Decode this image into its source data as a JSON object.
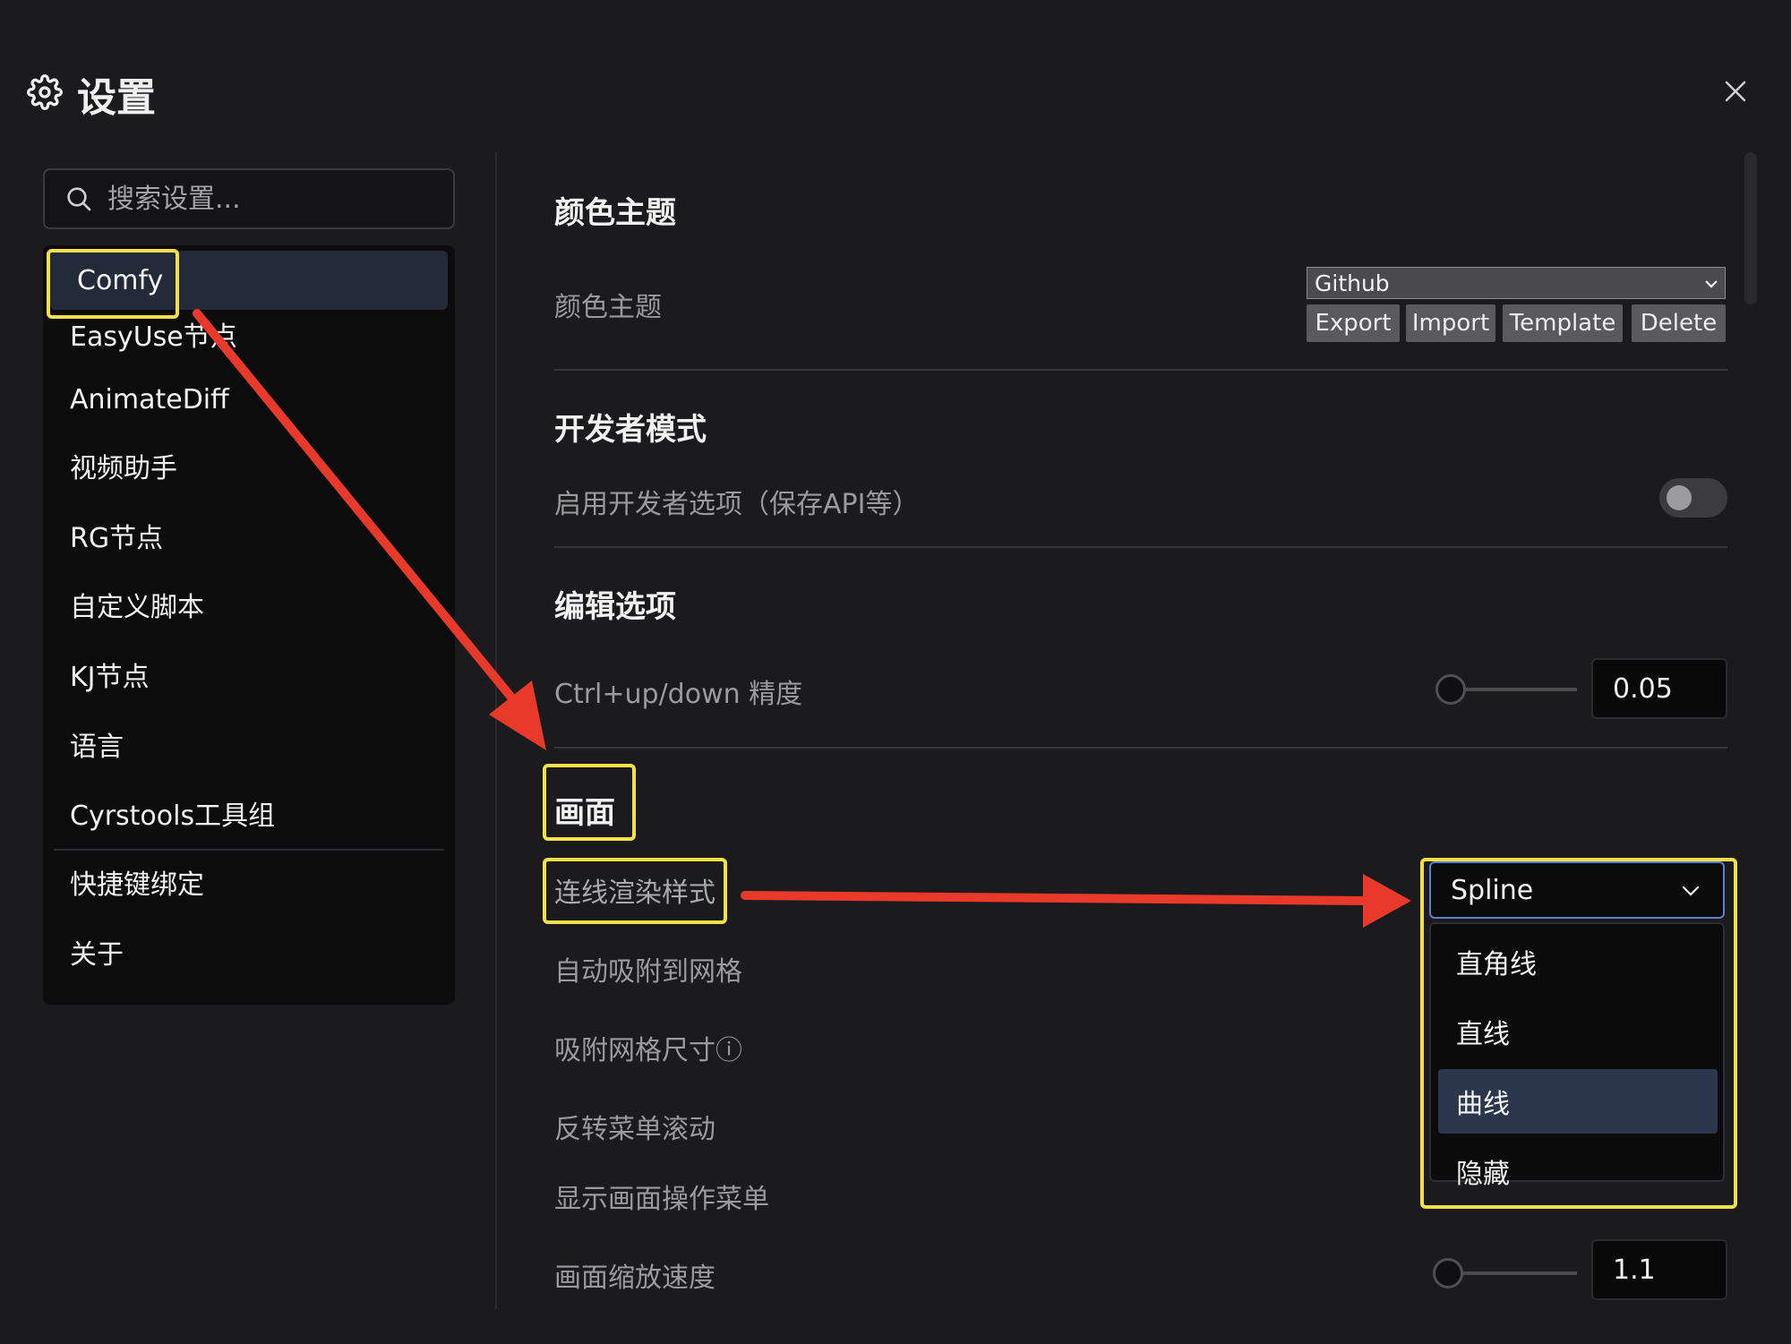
{
  "header": {
    "title": "设置",
    "icon": "gear-icon",
    "close_icon": "close-icon"
  },
  "search": {
    "placeholder": "搜索设置..."
  },
  "sidebar": {
    "items": [
      {
        "label": "Comfy"
      },
      {
        "label": "EasyUse节点"
      },
      {
        "label": "AnimateDiff"
      },
      {
        "label": "视频助手"
      },
      {
        "label": "RG节点"
      },
      {
        "label": "自定义脚本"
      },
      {
        "label": "KJ节点"
      },
      {
        "label": "语言"
      },
      {
        "label": "Cyrstools工具组"
      },
      {
        "label": "快捷键绑定"
      },
      {
        "label": "关于"
      }
    ],
    "selected": "Comfy"
  },
  "sections": {
    "color_theme": {
      "title": "颜色主题",
      "label": "颜色主题",
      "select_value": "Github",
      "buttons": [
        "Export",
        "Import",
        "Template",
        "Delete"
      ]
    },
    "dev_mode": {
      "title": "开发者模式",
      "label": "启用开发者选项（保存API等）",
      "toggle_on": false
    },
    "edit": {
      "title": "编辑选项",
      "label": "Ctrl+up/down 精度",
      "value": "0.05",
      "slider_level": 0
    },
    "canvas": {
      "title": "画面",
      "rows": [
        "连线渲染样式",
        "自动吸附到网格",
        "吸附网格尺寸ⓘ",
        "反转菜单滚动",
        "显示画面操作菜单",
        "画面缩放速度"
      ],
      "link_style_value": "Spline",
      "link_style_options": [
        "直角线",
        "直线",
        "曲线",
        "隐藏"
      ],
      "link_style_highlighted": "曲线",
      "zoom_speed_value": "1.1",
      "zoom_slider_level": 0
    }
  },
  "colors": {
    "highlight": "#f4e04a",
    "arrow": "#e8392a",
    "accent": "#5c7fd6",
    "selected_bg": "#232a3a"
  }
}
